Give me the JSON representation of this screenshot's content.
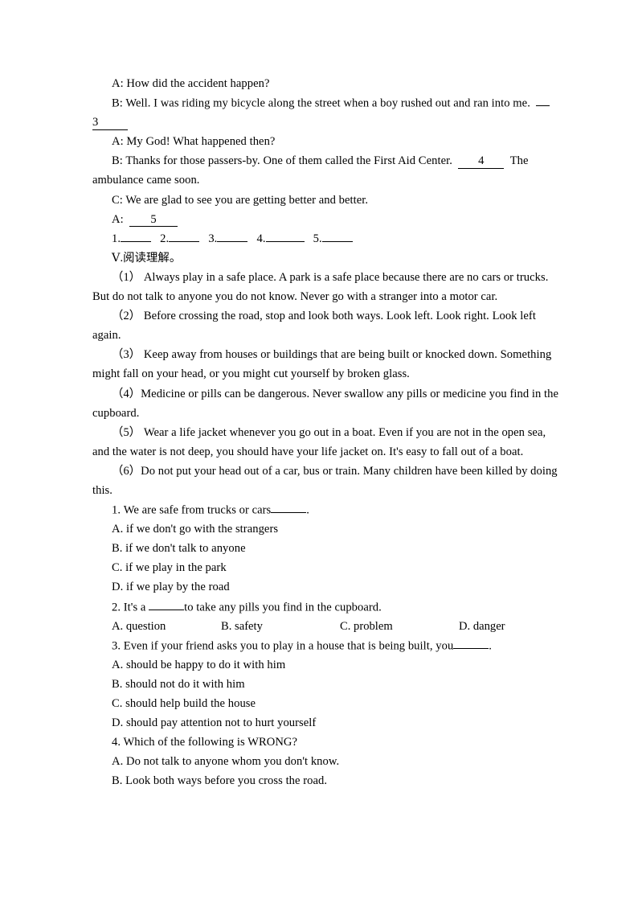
{
  "document": {
    "page_background": "#ffffff",
    "text_color": "#000000"
  },
  "dialogue": {
    "line_a1": "A: How did the accident happen?",
    "line_b1": "B: Well. I was riding my bicycle along the street when a boy rushed out and ran into me.",
    "blank_3": "3",
    "line_a2": "A: My God! What happened then?",
    "line_b2_part1": "B: Thanks for those passers-by. One of them called the First Aid Center.",
    "blank_4": "4",
    "line_b2_part2": "The",
    "line_b2_wrap": "ambulance came soon.",
    "line_c1": "C: We are glad to see you are getting better and better.",
    "line_a3_label": "A:",
    "blank_5": "5"
  },
  "answer_blanks": {
    "items": [
      "1.",
      "2.",
      "3.",
      "4.",
      "5."
    ]
  },
  "section": {
    "heading": "Ⅴ.阅读理解。"
  },
  "passage": {
    "paragraphs": [
      {
        "marker": "（1）",
        "lines": [
          "Always play in a safe place. A park is a safe place because there are no cars or trucks.",
          "But do not talk to anyone you do not know. Never go with a stranger into a motor car."
        ]
      },
      {
        "marker": "（2）",
        "lines": [
          "Before crossing the road, stop and look both ways. Look left. Look right. Look left",
          "again."
        ]
      },
      {
        "marker": "（3）",
        "lines": [
          "Keep away from houses or buildings that are being built or knocked down. Something",
          "might fall on your head, or you might cut yourself by broken glass."
        ]
      },
      {
        "marker": "（4）",
        "lines": [
          "Medicine or pills can be dangerous. Never swallow any pills or medicine you find in the",
          "cupboard."
        ]
      },
      {
        "marker": "（5）",
        "lines": [
          "Wear a life jacket whenever you go out in a boat. Even if you are not in the open sea,",
          "and the water is not deep, you should have your life jacket on. It's easy to fall out of a boat."
        ]
      },
      {
        "marker": "（6）",
        "lines": [
          "Do not put your head out of a car, bus or train. Many children have been killed by doing",
          "this."
        ]
      }
    ]
  },
  "questions": [
    {
      "number": "1.",
      "stem_before": "We are safe from trucks or cars",
      "stem_after": ".",
      "options": [
        "A. if we don't go with the strangers",
        "B. if we don't talk to anyone",
        "C. if we play in the park",
        "D. if we play by the road"
      ],
      "layout": "stacked"
    },
    {
      "number": "2.",
      "stem_before": "It's a",
      "stem_after": "to take any pills you find in the cupboard.",
      "options": [
        "A. question",
        "B. safety",
        "C. problem",
        "D. danger"
      ],
      "layout": "row"
    },
    {
      "number": "3.",
      "stem_before": "Even if your friend asks you to play in a house that is being built, you",
      "stem_after": ".",
      "options": [
        "A. should be happy to do it with him",
        "B. should not do it with him",
        "C. should help build the house",
        "D. should pay attention not to hurt yourself"
      ],
      "layout": "stacked"
    },
    {
      "number": "4.",
      "stem_full": "4. Which of the following is WRONG?",
      "options": [
        "A. Do not talk to anyone whom you don't know.",
        "B. Look both ways before you cross the road."
      ],
      "layout": "stacked"
    }
  ]
}
